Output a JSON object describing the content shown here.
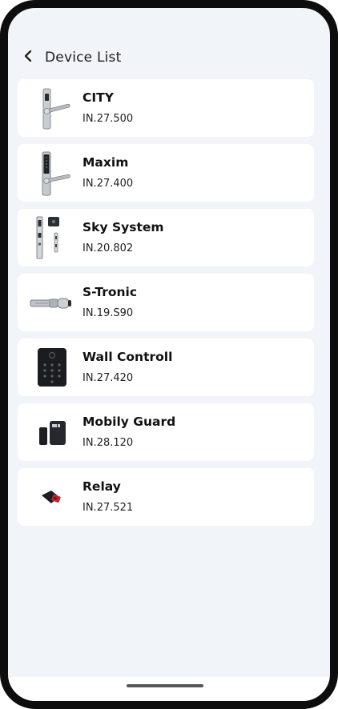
{
  "header": {
    "title": "Device List"
  },
  "devices": [
    {
      "name": "CITY",
      "code": "IN.27.500",
      "icon": "door-handle-lock-icon"
    },
    {
      "name": "Maxim",
      "code": "IN.27.400",
      "icon": "keypad-door-handle-icon"
    },
    {
      "name": "Sky System",
      "code": "IN.20.802",
      "icon": "mortise-lock-system-icon"
    },
    {
      "name": "S-Tronic",
      "code": "IN.19.S90",
      "icon": "cylinder-lock-icon"
    },
    {
      "name": "Wall Controll",
      "code": "IN.27.420",
      "icon": "wall-keypad-icon"
    },
    {
      "name": "Mobily Guard",
      "code": "IN.28.120",
      "icon": "door-sensor-icon"
    },
    {
      "name": "Relay",
      "code": "IN.27.521",
      "icon": "relay-module-icon"
    }
  ],
  "colors": {
    "background": "#f1f4f8",
    "card": "#ffffff",
    "frame": "#0d0d0d"
  }
}
